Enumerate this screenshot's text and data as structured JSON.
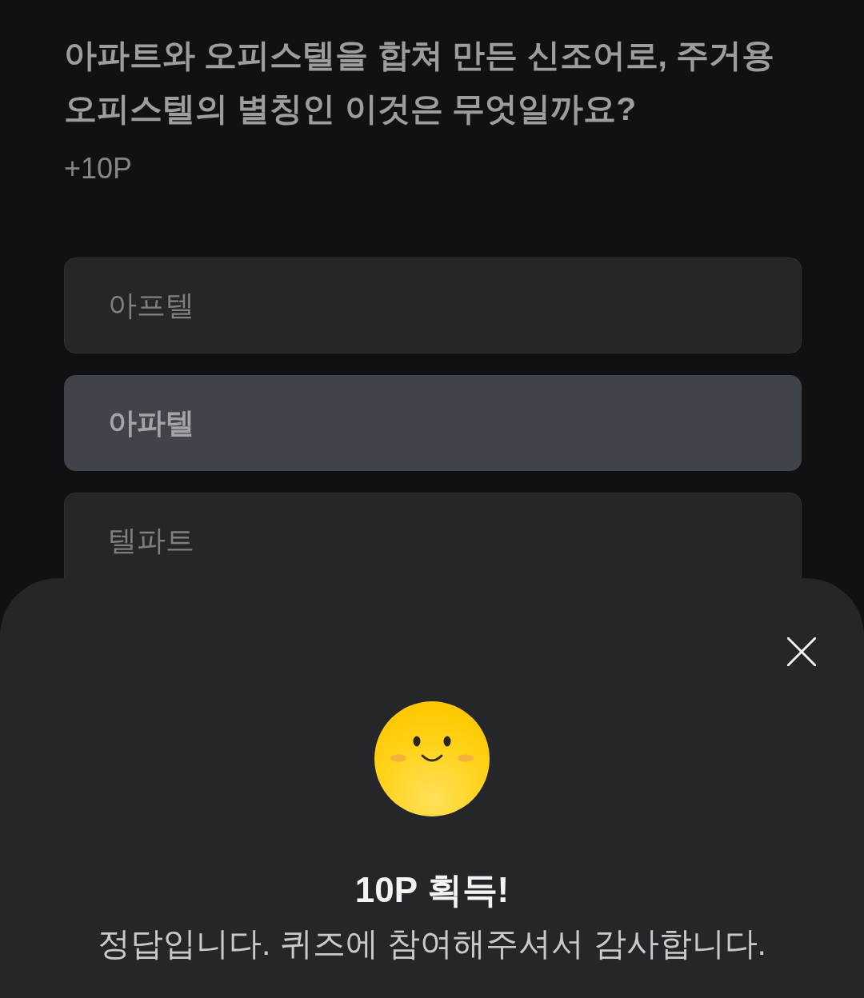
{
  "question": {
    "text": "아파트와 오피스텔을 합쳐 만든 신조어로, 주거용 오피스텔의 별칭인 이것은 무엇일까요?",
    "points": "+10P"
  },
  "options": [
    {
      "label": "아프텔",
      "selected": false
    },
    {
      "label": "아파텔",
      "selected": true
    },
    {
      "label": "텔파트",
      "selected": false
    }
  ],
  "result_sheet": {
    "title": "10P 획득!",
    "message": "정답입니다. 퀴즈에 참여해주셔서 감사합니다."
  }
}
